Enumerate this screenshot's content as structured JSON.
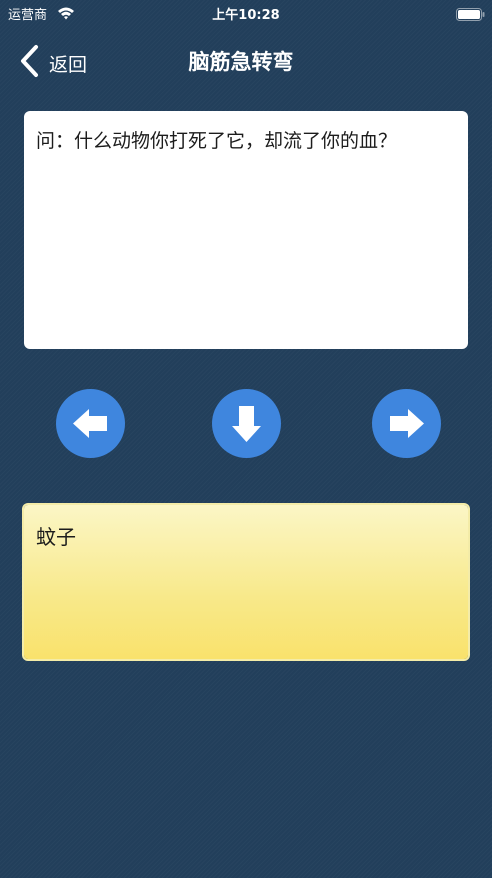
{
  "status_bar": {
    "carrier": "运营商",
    "time": "上午10:28"
  },
  "nav": {
    "back_label": "返回",
    "title": "脑筋急转弯"
  },
  "question": {
    "text": "问：什么动物你打死了它，却流了你的血？"
  },
  "answer": {
    "text": "蚊子"
  },
  "controls": {
    "prev_icon": "arrow-left-icon",
    "reveal_icon": "arrow-down-icon",
    "next_icon": "arrow-right-icon",
    "button_color": "#3f86de"
  },
  "colors": {
    "background": "#223f5b",
    "answer_gradient_top": "#fbf6c6",
    "answer_gradient_bottom": "#f9e26c"
  }
}
